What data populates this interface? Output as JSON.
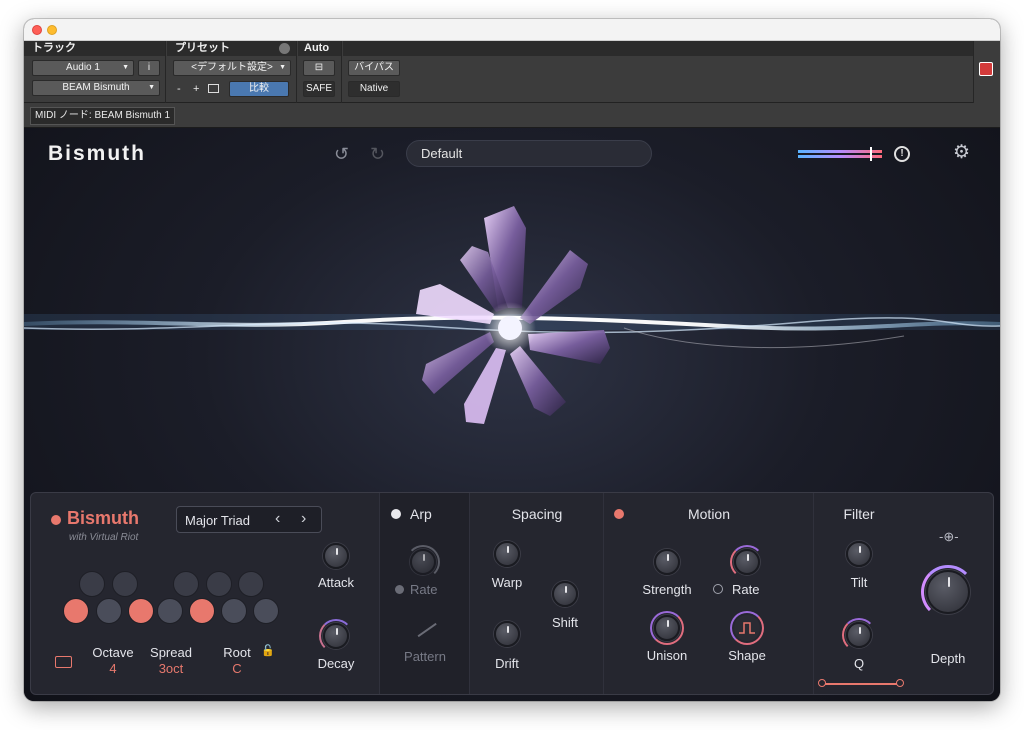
{
  "host": {
    "track_header": "トラック",
    "preset_header": "プリセット",
    "auto_header": "Auto",
    "track_name": "Audio 1",
    "track_i": "i",
    "insert_name": "BEAM Bismuth",
    "preset_name": "<デフォルト設定>",
    "preset_minus": "-",
    "preset_plus": "+",
    "compare": "比較",
    "safe": "SAFE",
    "bypass": "バイパス",
    "native": "Native",
    "midi_node": "MIDI ノード: BEAM Bismuth 1"
  },
  "plugin": {
    "brand": "Bismuth",
    "preset": "Default"
  },
  "panel": {
    "bismuth": {
      "title": "Bismuth",
      "subtitle": "with Virtual Riot",
      "chord": "Major Triad"
    },
    "controls": {
      "octave_label": "Octave",
      "octave_value": "4",
      "spread_label": "Spread",
      "spread_value": "3oct",
      "root_label": "Root",
      "root_value": "C",
      "attack": "Attack",
      "decay": "Decay"
    },
    "arp": {
      "title": "Arp",
      "rate": "Rate",
      "pattern": "Pattern"
    },
    "spacing": {
      "title": "Spacing",
      "warp": "Warp",
      "shift": "Shift",
      "drift": "Drift"
    },
    "motion": {
      "title": "Motion",
      "strength": "Strength",
      "rate": "Rate",
      "unison": "Unison",
      "shape": "Shape"
    },
    "filter": {
      "title": "Filter",
      "tilt": "Tilt",
      "q": "Q"
    },
    "depth": "Depth"
  },
  "colors": {
    "accent": "#e8786d",
    "panel": "#25262f",
    "background": "#14151c"
  }
}
